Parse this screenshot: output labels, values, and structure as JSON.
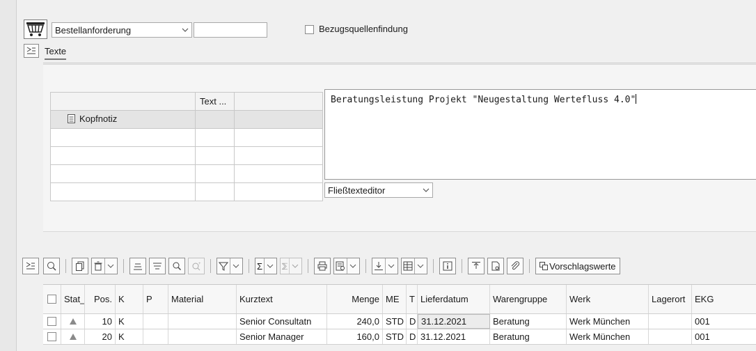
{
  "header": {
    "doc_type": "Bestellanforderung",
    "doc_number": "",
    "source_check_label": "Bezugsquellenfindung"
  },
  "tabs": [
    "Texte"
  ],
  "text_tree": {
    "col_text": "Text ...",
    "rows": [
      {
        "label": "Kopfnotiz",
        "text": "",
        "extra": ""
      }
    ]
  },
  "editor": {
    "content": "Beratungsleistung Projekt \"Neugestaltung Wertefluss 4.0\"",
    "mode": "Fließtexteditor"
  },
  "toolbar": {
    "vorschlag_label": "Vorschlagswerte"
  },
  "grid": {
    "columns": [
      "Stat_",
      "Pos.",
      "K",
      "P",
      "Material",
      "Kurztext",
      "Menge",
      "ME",
      "T",
      "Lieferdatum",
      "Warengruppe",
      "Werk",
      "Lagerort",
      "EKG"
    ],
    "rows": [
      {
        "pos": "10",
        "k": "K",
        "p": "",
        "material": "",
        "kurztext": "Senior Consultatn",
        "menge": "240,0",
        "me": "STD",
        "t": "D",
        "lieferdatum": "31.12.2021",
        "warengruppe": "Beratung",
        "werk": "Werk München",
        "lagerort": "",
        "ekg": "001"
      },
      {
        "pos": "20",
        "k": "K",
        "p": "",
        "material": "",
        "kurztext": "Senior Manager",
        "menge": "160,0",
        "me": "STD",
        "t": "D",
        "lieferdatum": "31.12.2021",
        "warengruppe": "Beratung",
        "werk": "Werk München",
        "lagerort": "",
        "ekg": "001"
      }
    ]
  }
}
